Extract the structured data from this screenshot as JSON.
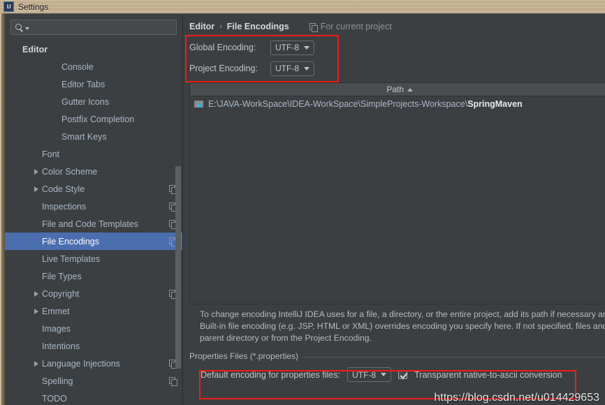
{
  "window": {
    "title": "Settings",
    "app_icon": "intellij-idea-icon"
  },
  "sidebar": {
    "search": {
      "value": "",
      "placeholder": ""
    },
    "items": [
      {
        "label": "Editor",
        "indent": 0,
        "bold": true,
        "twisty": false,
        "copy": false,
        "selected": false
      },
      {
        "label": "Console",
        "indent": 2,
        "bold": false,
        "twisty": false,
        "copy": false,
        "selected": false
      },
      {
        "label": "Editor Tabs",
        "indent": 2,
        "bold": false,
        "twisty": false,
        "copy": false,
        "selected": false
      },
      {
        "label": "Gutter Icons",
        "indent": 2,
        "bold": false,
        "twisty": false,
        "copy": false,
        "selected": false
      },
      {
        "label": "Postfix Completion",
        "indent": 2,
        "bold": false,
        "twisty": false,
        "copy": false,
        "selected": false
      },
      {
        "label": "Smart Keys",
        "indent": 2,
        "bold": false,
        "twisty": false,
        "copy": false,
        "selected": false
      },
      {
        "label": "Font",
        "indent": 1,
        "bold": false,
        "twisty": false,
        "copy": false,
        "selected": false
      },
      {
        "label": "Color Scheme",
        "indent": 1,
        "bold": false,
        "twisty": true,
        "copy": false,
        "selected": false
      },
      {
        "label": "Code Style",
        "indent": 1,
        "bold": false,
        "twisty": true,
        "copy": true,
        "selected": false
      },
      {
        "label": "Inspections",
        "indent": 1,
        "bold": false,
        "twisty": false,
        "copy": true,
        "selected": false
      },
      {
        "label": "File and Code Templates",
        "indent": 1,
        "bold": false,
        "twisty": false,
        "copy": true,
        "selected": false
      },
      {
        "label": "File Encodings",
        "indent": 1,
        "bold": false,
        "twisty": false,
        "copy": true,
        "selected": true
      },
      {
        "label": "Live Templates",
        "indent": 1,
        "bold": false,
        "twisty": false,
        "copy": false,
        "selected": false
      },
      {
        "label": "File Types",
        "indent": 1,
        "bold": false,
        "twisty": false,
        "copy": false,
        "selected": false
      },
      {
        "label": "Copyright",
        "indent": 1,
        "bold": false,
        "twisty": true,
        "copy": true,
        "selected": false
      },
      {
        "label": "Emmet",
        "indent": 1,
        "bold": false,
        "twisty": true,
        "copy": false,
        "selected": false
      },
      {
        "label": "Images",
        "indent": 1,
        "bold": false,
        "twisty": false,
        "copy": false,
        "selected": false
      },
      {
        "label": "Intentions",
        "indent": 1,
        "bold": false,
        "twisty": false,
        "copy": false,
        "selected": false
      },
      {
        "label": "Language Injections",
        "indent": 1,
        "bold": false,
        "twisty": true,
        "copy": true,
        "selected": false
      },
      {
        "label": "Spelling",
        "indent": 1,
        "bold": false,
        "twisty": false,
        "copy": true,
        "selected": false
      },
      {
        "label": "TODO",
        "indent": 1,
        "bold": false,
        "twisty": false,
        "copy": false,
        "selected": false
      }
    ]
  },
  "content": {
    "breadcrumb": {
      "parent": "Editor",
      "separator": "›",
      "current": "File Encodings"
    },
    "scope_note": "For current project",
    "encodings": [
      {
        "label": "Global Encoding:",
        "value": "UTF-8"
      },
      {
        "label": "Project Encoding:",
        "value": "UTF-8"
      }
    ],
    "table": {
      "column_header": "Path",
      "sort": "ascending",
      "rows": [
        {
          "path_prefix": "E:\\JAVA-WorkSpace\\IDEA-WorkSpace\\SimpleProjects-Workspace\\",
          "path_name": "SpringMaven"
        }
      ]
    },
    "help_lines": [
      "To change encoding IntelliJ IDEA uses for a file, a directory, or the entire project, add its path if necessary and",
      "Built-in file encoding (e.g. JSP, HTML or XML) overrides encoding you specify here. If not specified, files and d",
      "parent directory or from the Project Encoding."
    ],
    "properties_group": {
      "title": "Properties Files (*.properties)",
      "encoding_label": "Default encoding for properties files:",
      "encoding_value": "UTF-8",
      "checkbox_label": "Transparent native-to-ascii conversion",
      "checkbox_checked": true
    }
  },
  "watermark": "https://blog.csdn.net/u014429653",
  "colors": {
    "accent_selection": "#4b6eaf",
    "panel_bg": "#3c3f41",
    "text": "#a9b7c6",
    "annotation_red": "#ee1c1c"
  }
}
